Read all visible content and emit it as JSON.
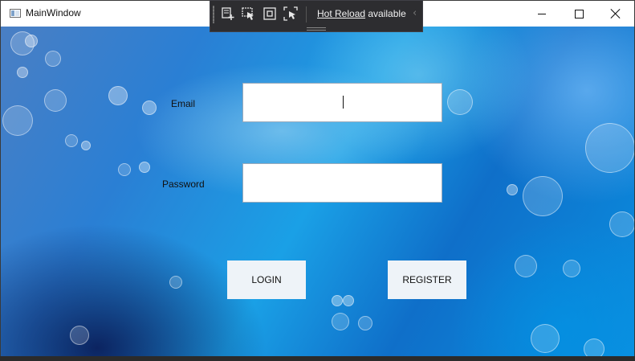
{
  "window": {
    "title": "MainWindow"
  },
  "hot_reload_toolbar": {
    "link_text": "Hot Reload",
    "status_text": " available",
    "tools": [
      "add-element-icon",
      "select-element-icon",
      "display-layout-adorners-icon",
      "track-focus-icon"
    ]
  },
  "form": {
    "email_label": "Email",
    "password_label": "Password",
    "email_value": "",
    "password_value": "",
    "login_label": "LOGIN",
    "register_label": "REGISTER"
  },
  "colors": {
    "titlebar": "#ffffff",
    "toolbar_bg": "#2d2d30",
    "button_bg": "#eef3f8",
    "accent_blue": "#1aa0e6"
  }
}
